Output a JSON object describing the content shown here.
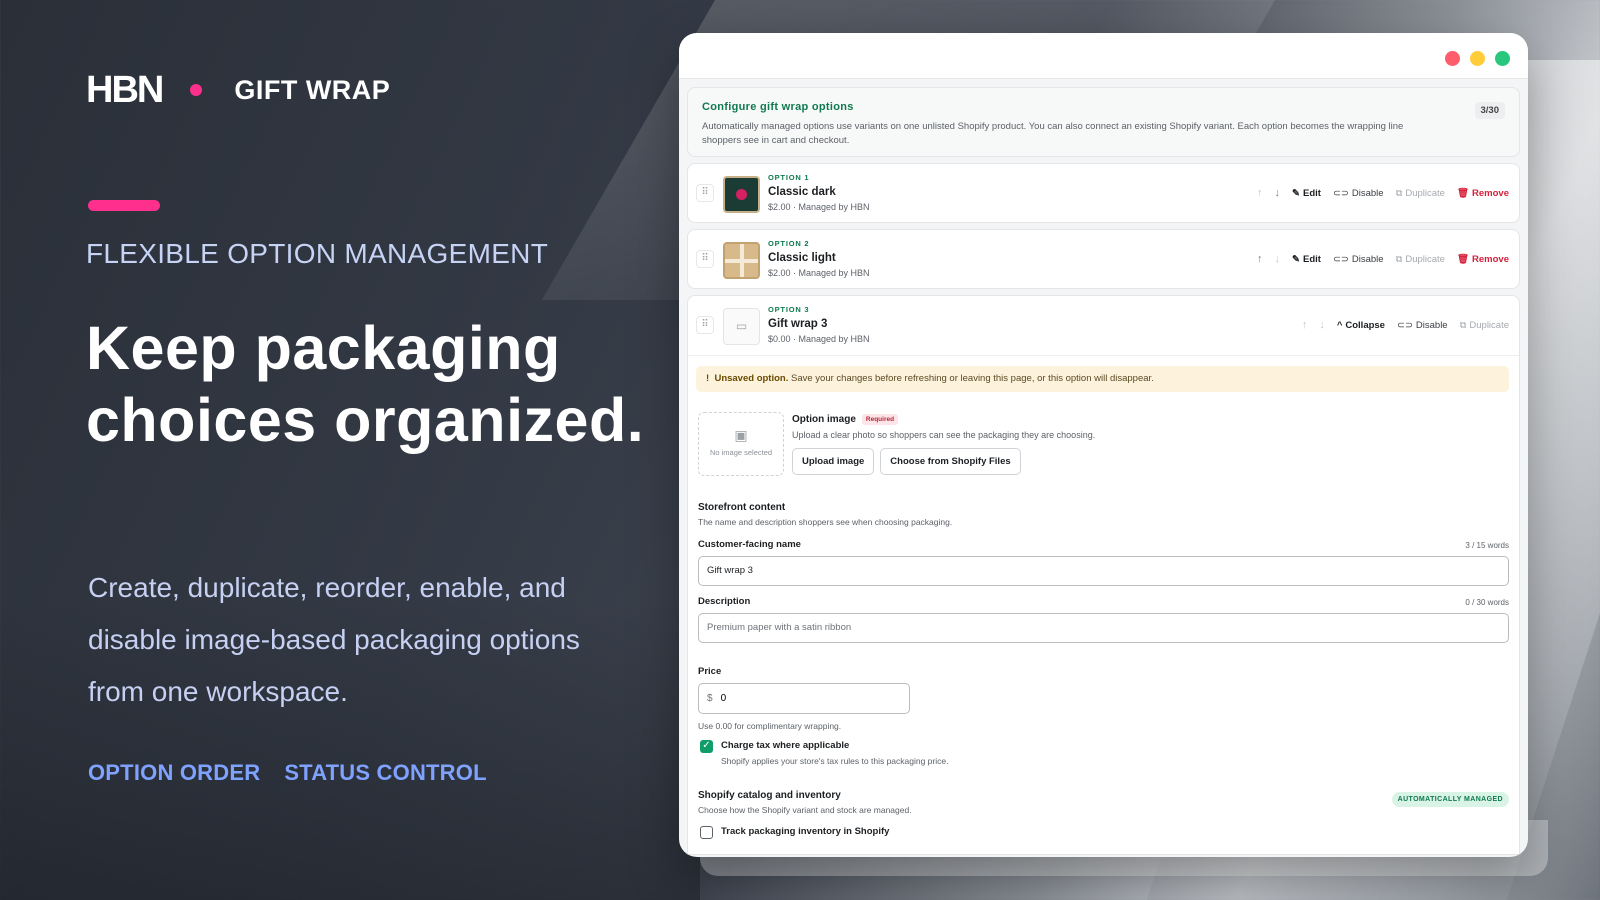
{
  "hero": {
    "logo": "HBN",
    "product": "GIFT WRAP",
    "eyebrow": "FLEXIBLE OPTION MANAGEMENT",
    "headline": "Keep packaging choices organized.",
    "subtext": "Create, duplicate, reorder, enable, and disable image-based packaging options from one workspace.",
    "tags": [
      "OPTION ORDER",
      "STATUS CONTROL"
    ]
  },
  "colors": {
    "accent": "#ff2f8e",
    "green": "#0f7a4f",
    "danger": "#d61f3a"
  },
  "config": {
    "title": "Configure gift wrap options",
    "description": "Automatically managed options use variants on one unlisted Shopify product. You can also connect an existing Shopify variant. Each option becomes the wrapping line shoppers see in cart and checkout.",
    "count": "3/30"
  },
  "actions": {
    "edit": "Edit",
    "disable": "Disable",
    "duplicate": "Duplicate",
    "remove": "Remove",
    "collapse": "Collapse"
  },
  "options": [
    {
      "label": "OPTION 1",
      "name": "Classic dark",
      "meta": "$2.00 · Managed by HBN"
    },
    {
      "label": "OPTION 2",
      "name": "Classic light",
      "meta": "$2.00 · Managed by HBN"
    },
    {
      "label": "OPTION 3",
      "name": "Gift wrap 3",
      "meta": "$0.00 · Managed by HBN"
    }
  ],
  "editor": {
    "warning_bold": "Unsaved option.",
    "warning_text": " Save your changes before refreshing or leaving this page, or this option will disappear.",
    "no_image": "No image selected",
    "image_title": "Option image",
    "required": "Required",
    "image_help": "Upload a clear photo so shoppers can see the packaging they are choosing.",
    "upload_btn": "Upload image",
    "choose_btn": "Choose from Shopify Files",
    "storefront_title": "Storefront content",
    "storefront_help": "The name and description shoppers see when choosing packaging.",
    "name_label": "Customer-facing name",
    "name_count": "3 / 15 words",
    "name_value": "Gift wrap 3",
    "desc_label": "Description",
    "desc_count": "0 / 30 words",
    "desc_placeholder": "Premium paper with a satin ribbon",
    "price_label": "Price",
    "currency": "$",
    "price_value": "0",
    "price_hint": "Use 0.00 for complimentary wrapping.",
    "tax_label": "Charge tax where applicable",
    "tax_help": "Shopify applies your store's tax rules to this packaging price.",
    "tax_checked": true,
    "catalog_title": "Shopify catalog and inventory",
    "catalog_help": "Choose how the Shopify variant and stock are managed.",
    "catalog_badge": "AUTOMATICALLY MANAGED",
    "track_label": "Track packaging inventory in Shopify",
    "track_checked": false
  }
}
